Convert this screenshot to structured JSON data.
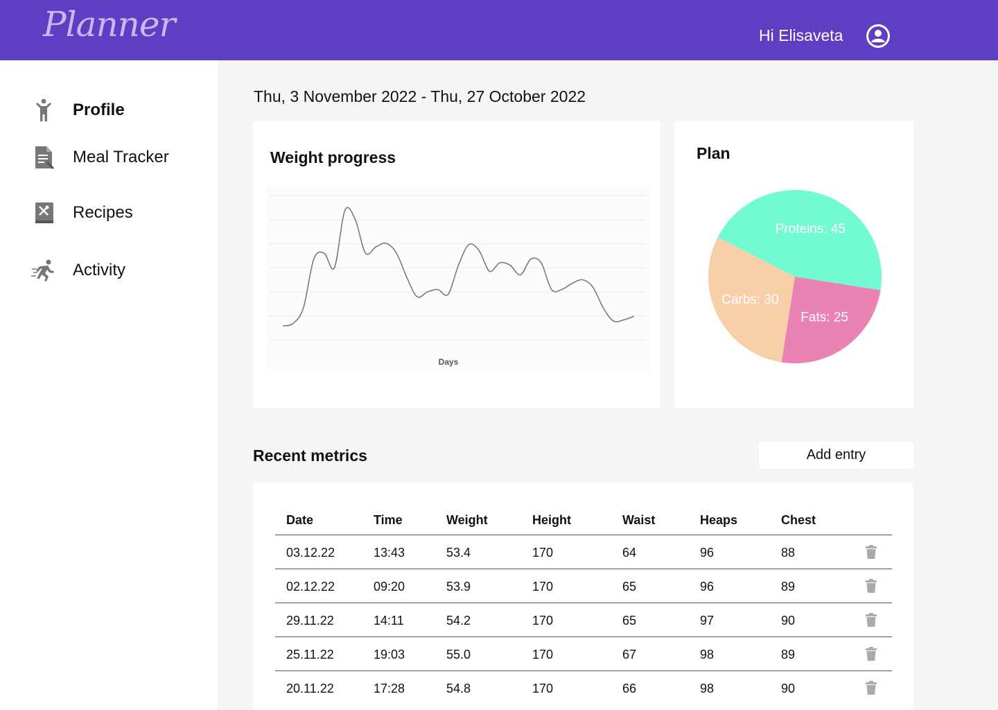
{
  "header": {
    "logo": "Planner",
    "greeting": "Hi Elisaveta",
    "brand_color": "#5e3ec3",
    "avatar_icon": "user-avatar-icon"
  },
  "sidebar": {
    "items": [
      {
        "label": "Profile",
        "icon": "person-icon",
        "active": true
      },
      {
        "label": "Meal Tracker",
        "icon": "document-icon",
        "active": false
      },
      {
        "label": "Recipes",
        "icon": "recipe-book-icon",
        "active": false
      },
      {
        "label": "Activity",
        "icon": "running-icon",
        "active": false
      }
    ]
  },
  "date_range": "Thu, 3 November 2022 - Thu, 27 October 2022",
  "weight_card": {
    "title": "Weight progress",
    "xlabel": "Days"
  },
  "plan_card": {
    "title": "Plan"
  },
  "chart_data": [
    {
      "type": "line",
      "title": "Weight progress",
      "xlabel": "Days",
      "ylabel": "",
      "grid": true,
      "line_color": "#7a7a7a",
      "series": [
        {
          "values": [
            0.0,
            0.02,
            0.15,
            0.55,
            0.6,
            0.48,
            0.95,
            0.88,
            0.6,
            0.65,
            0.68,
            0.6,
            0.4,
            0.24,
            0.28,
            0.3,
            0.26,
            0.5,
            0.67,
            0.62,
            0.45,
            0.52,
            0.5,
            0.42,
            0.55,
            0.52,
            0.3,
            0.3,
            0.35,
            0.38,
            0.32,
            0.15,
            0.04,
            0.05,
            0.08
          ]
        }
      ]
    },
    {
      "type": "pie",
      "title": "Plan",
      "slices": [
        {
          "label": "Proteins: 45",
          "value": 45,
          "color": "#72fad2"
        },
        {
          "label": "Fats: 25",
          "value": 25,
          "color": "#ea82b4"
        },
        {
          "label": "Carbs: 30",
          "value": 30,
          "color": "#f7cfa8"
        }
      ]
    }
  ],
  "metrics": {
    "title": "Recent metrics",
    "add_label": "Add entry",
    "columns": [
      "Date",
      "Time",
      "Weight",
      "Height",
      "Waist",
      "Heaps",
      "Chest"
    ],
    "rows": [
      [
        "03.12.22",
        "13:43",
        "53.4",
        "170",
        "64",
        "96",
        "88"
      ],
      [
        "02.12.22",
        "09:20",
        "53.9",
        "170",
        "65",
        "96",
        "89"
      ],
      [
        "29.11.22",
        "14:11",
        "54.2",
        "170",
        "65",
        "97",
        "90"
      ],
      [
        "25.11.22",
        "19:03",
        "55.0",
        "170",
        "67",
        "98",
        "89"
      ],
      [
        "20.11.22",
        "17:28",
        "54.8",
        "170",
        "66",
        "98",
        "90"
      ]
    ],
    "row_action_icon": "trash-icon"
  }
}
